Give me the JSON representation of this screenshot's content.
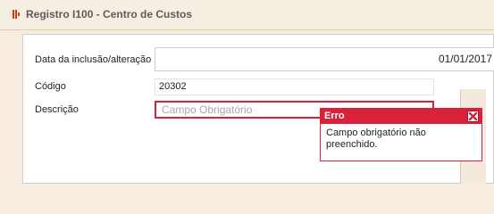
{
  "window": {
    "title": "Registro I100 - Centro de Custos"
  },
  "form": {
    "date_label": "Data da inclusão/alteração",
    "date_value": "01/01/2017",
    "code_label": "Código",
    "code_value": "20302",
    "description_label": "Descrição",
    "description_placeholder": "Campo Obrigatório"
  },
  "error": {
    "title": "Erro",
    "message": "Campo obrigatório não preenchido.",
    "close_icon": "close-x-icon"
  },
  "colors": {
    "error_red": "#d8213a",
    "title_accent": "#c8401a",
    "background": "#f6ecdf"
  }
}
